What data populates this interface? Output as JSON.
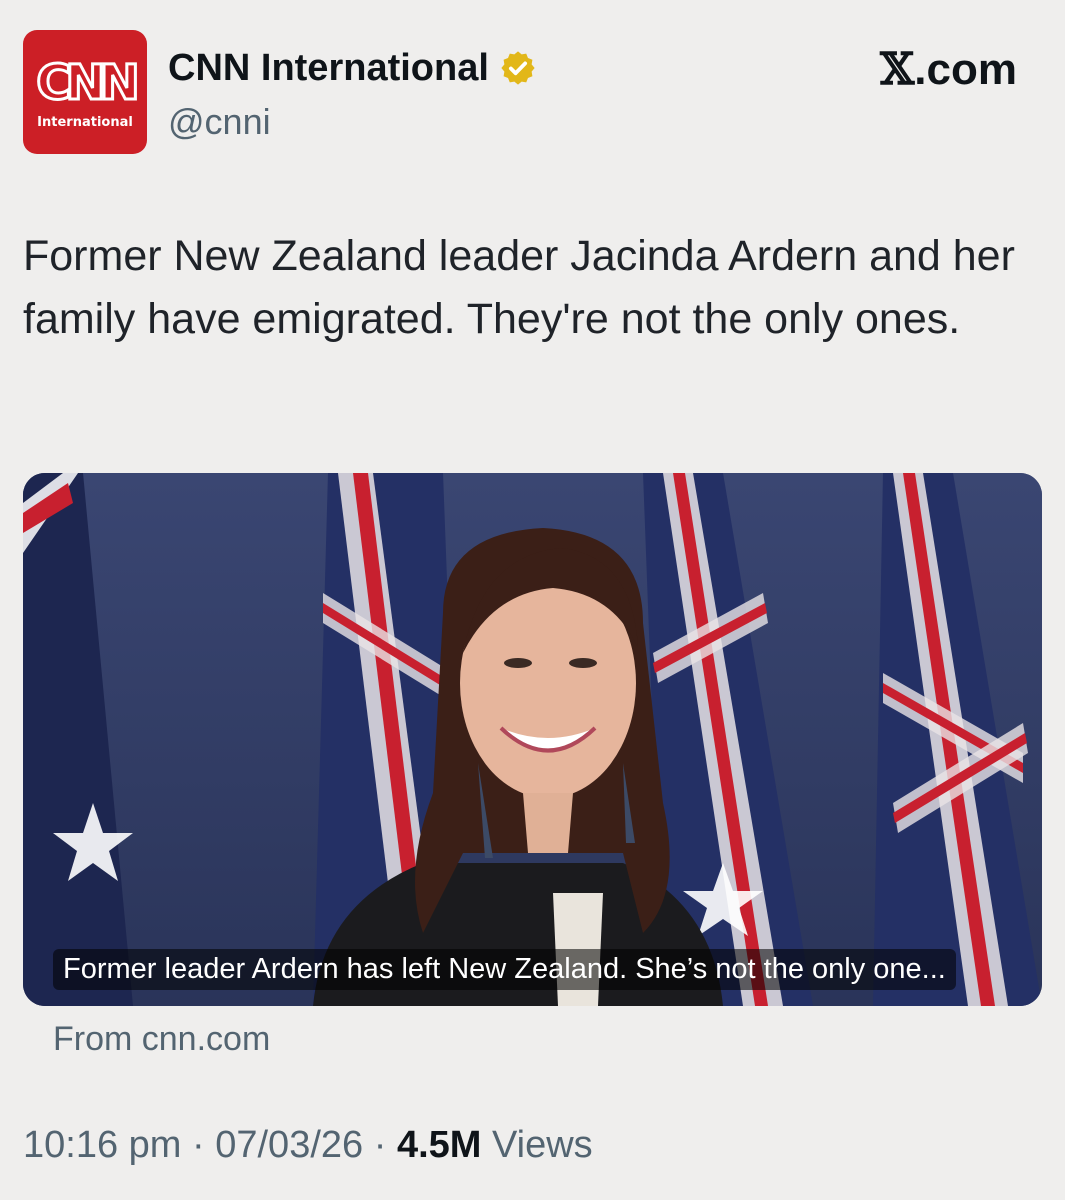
{
  "account": {
    "avatar_logo": "CNN",
    "avatar_subtitle": "International",
    "display_name": "CNN International",
    "handle": "@cnni",
    "verified": true,
    "verified_color": "#e2b719"
  },
  "site_brand": {
    "x_glyph": "𝕏",
    "suffix": ".com"
  },
  "tweet": {
    "text": "Former New Zealand leader Jacinda Ardern and her family have emigrated. They're not the only ones."
  },
  "card": {
    "caption": "Former leader Ardern has left New Zealand. She’s not the only one...",
    "source": "From cnn.com"
  },
  "meta": {
    "time": "10:16 pm",
    "sep1": " · ",
    "date": "07/03/26",
    "sep2": " · ",
    "views_count": "4.5M",
    "views_label": " Views"
  },
  "colors": {
    "brand_red": "#cc1f26",
    "background": "#efeeed",
    "muted_text": "#536471"
  }
}
